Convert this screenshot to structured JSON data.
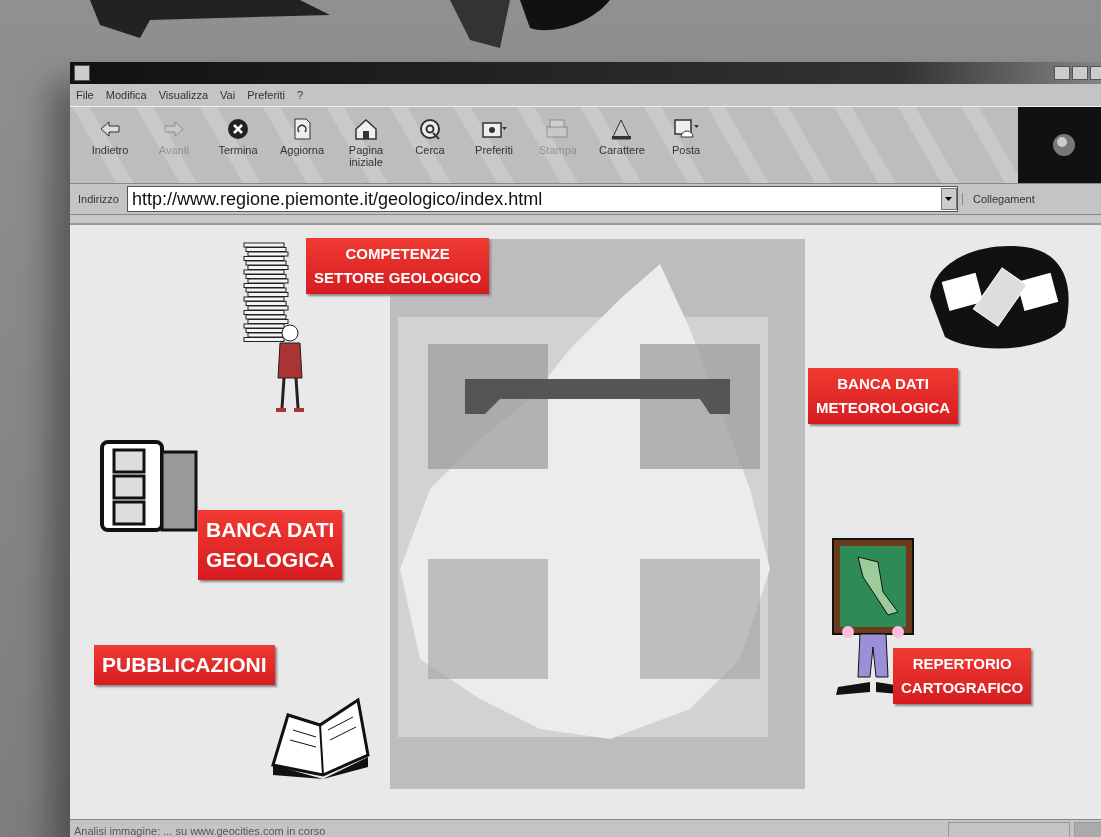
{
  "menu": [
    "File",
    "Modifica",
    "Visualizza",
    "Vai",
    "Preferiti",
    "?"
  ],
  "toolbar": [
    {
      "kind": "back",
      "label": "Indietro",
      "disabled": false
    },
    {
      "kind": "forward",
      "label": "Avanti",
      "disabled": true
    },
    {
      "kind": "stop",
      "label": "Termina",
      "disabled": false
    },
    {
      "kind": "refresh",
      "label": "Aggiorna",
      "disabled": false
    },
    {
      "kind": "home",
      "label": "Pagina iniziale",
      "disabled": false
    },
    {
      "kind": "search",
      "label": "Cerca",
      "disabled": false
    },
    {
      "kind": "favorites",
      "label": "Preferiti",
      "disabled": false
    },
    {
      "kind": "print",
      "label": "Stampa",
      "disabled": true
    },
    {
      "kind": "font",
      "label": "Carattere",
      "disabled": false
    },
    {
      "kind": "mail",
      "label": "Posta",
      "disabled": false
    }
  ],
  "address": {
    "label": "Indirizzo",
    "value": "http://www.regione.piemonte.it/geologico/index.html",
    "links_label": "Collegament"
  },
  "page_links": [
    {
      "kind": "papers",
      "text": "COMPETENZE\nSETTORE GEOLOGICO"
    },
    {
      "kind": "satellite",
      "text": "BANCA DATI\nMETEOROLOGICA"
    },
    {
      "kind": "cabinet",
      "text": "BANCA DATI\nGEOLOGICA"
    },
    {
      "kind": "book",
      "text": "PUBBLICAZIONI"
    },
    {
      "kind": "map",
      "text": "REPERTORIO\nCARTOGRAFICO"
    }
  ],
  "status_bar": {
    "text": "Analisi immagine: ... su www.geocities.com in corso"
  }
}
